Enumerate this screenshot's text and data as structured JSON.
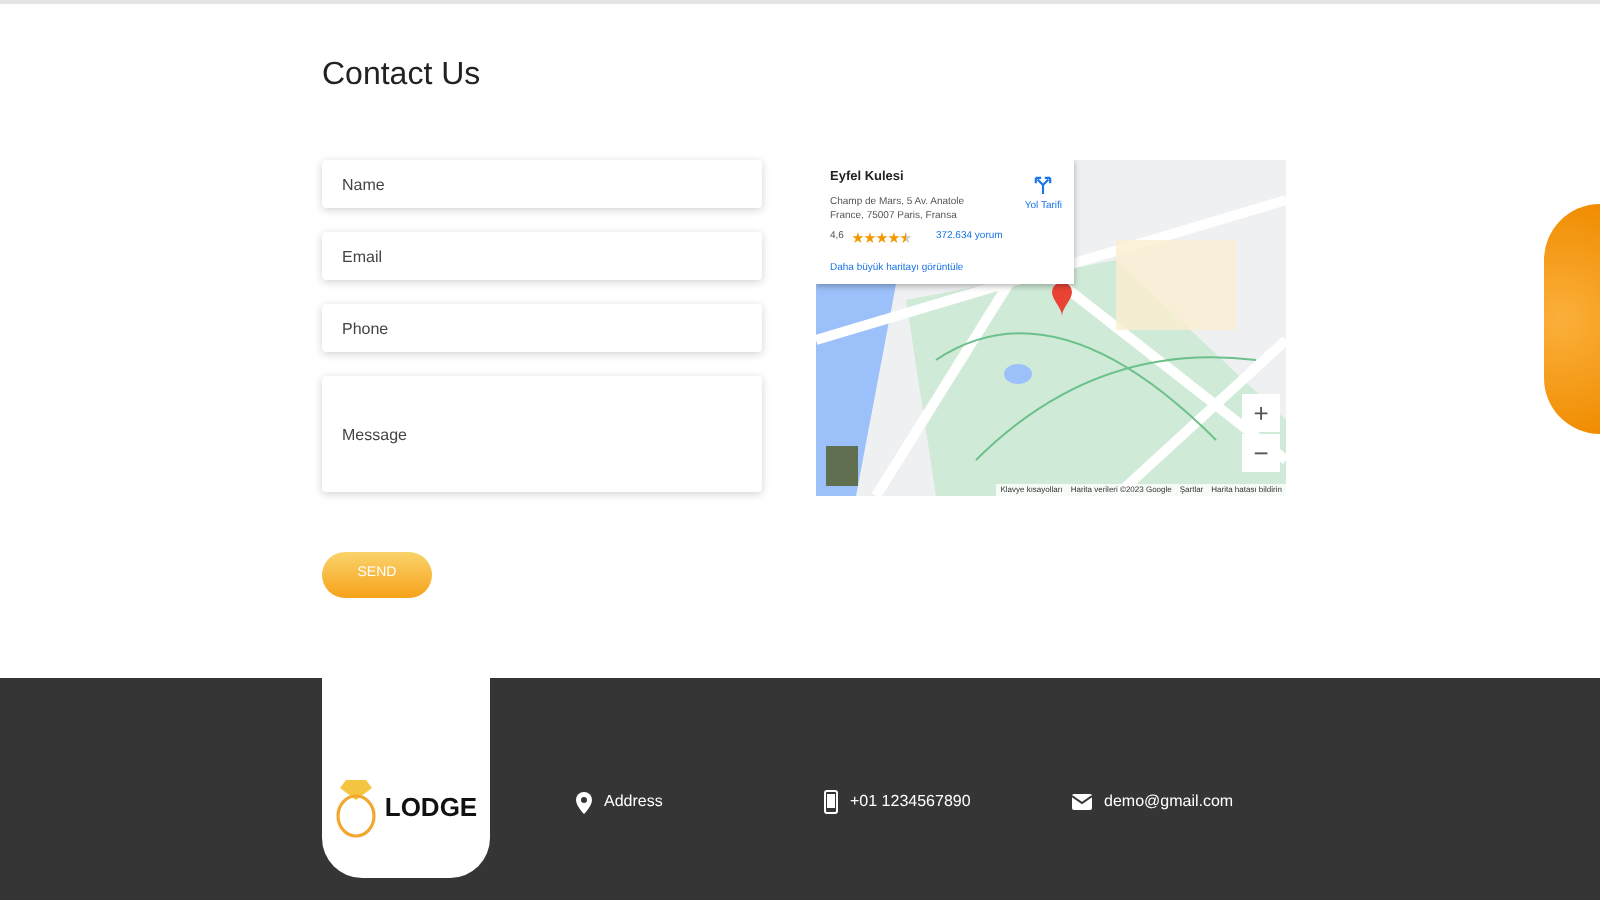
{
  "heading": "Contact Us",
  "form": {
    "fields": [
      {
        "kind": "input",
        "placeholder": "Name"
      },
      {
        "kind": "input",
        "placeholder": "Email"
      },
      {
        "kind": "input",
        "placeholder": "Phone"
      },
      {
        "kind": "textarea",
        "placeholder": "Message"
      }
    ],
    "submit": "SEND"
  },
  "map": {
    "place_card": {
      "title": "Eyfel Kulesi",
      "address": "Champ de Mars, 5 Av. Anatole France, 75007 Paris, Fransa",
      "rating": "4,6",
      "stars": 4.5,
      "reviews": "372.634 yorum",
      "directions": "Yol Tarifi",
      "larger_map_link": "Daha büyük haritayı görüntüle"
    },
    "zoom_in": "+",
    "zoom_out": "−",
    "attribution": [
      "Klavye kısayolları",
      "Harita verileri ©2023 Google",
      "Şartlar",
      "Harita hatası bildirin"
    ]
  },
  "footer": {
    "logo": "LODGE",
    "contacts": [
      {
        "kind": "address",
        "text": "Address"
      },
      {
        "kind": "phone",
        "text": "+01 1234567890"
      },
      {
        "kind": "email",
        "text": "demo@gmail.com"
      }
    ]
  }
}
